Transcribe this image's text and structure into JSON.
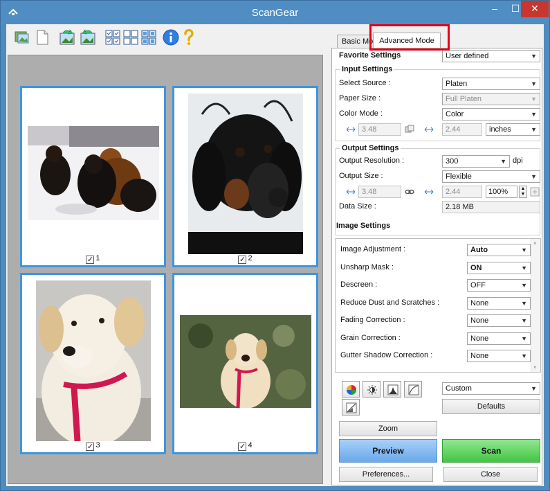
{
  "window": {
    "title": "ScanGear"
  },
  "window_controls": {
    "minimize": "–",
    "maximize": "☐",
    "close": "✕"
  },
  "toolbar": {
    "icons": [
      "open-image-icon",
      "new-document-icon",
      "rotate-left-icon",
      "rotate-right-icon",
      "auto-crop-icon",
      "deselect-all-icon",
      "select-all-icon",
      "info-icon",
      "help-icon"
    ]
  },
  "thumbnails": [
    {
      "number": "1",
      "checked": true,
      "subject": "three dogs"
    },
    {
      "number": "2",
      "checked": true,
      "subject": "dachshund"
    },
    {
      "number": "3",
      "checked": true,
      "subject": "labrador"
    },
    {
      "number": "4",
      "checked": true,
      "subject": "labrador on grass"
    }
  ],
  "tabs": {
    "basic": "Basic Mode",
    "advanced": "Advanced Mode"
  },
  "favorite": {
    "label": "Favorite Settings",
    "value": "User defined"
  },
  "input": {
    "title": "Input Settings",
    "source_label": "Select Source :",
    "source_value": "Platen",
    "paper_label": "Paper Size :",
    "paper_value": "Full Platen",
    "color_label": "Color Mode :",
    "color_value": "Color",
    "width": "3.48",
    "height": "2.44",
    "unit": "inches"
  },
  "output": {
    "title": "Output Settings",
    "resolution_label": "Output Resolution :",
    "resolution_value": "300",
    "dpi": "dpi",
    "size_label": "Output Size :",
    "size_value": "Flexible",
    "width": "3.48",
    "height": "2.44",
    "scale": "100%",
    "data_label": "Data Size :",
    "data_value": "2.18 MB"
  },
  "image_settings": {
    "title": "Image Settings",
    "rows": [
      {
        "label": "Image Adjustment :",
        "value": "Auto",
        "bold": true
      },
      {
        "label": "Unsharp Mask :",
        "value": "ON",
        "bold": true
      },
      {
        "label": "Descreen :",
        "value": "OFF",
        "bold": false
      },
      {
        "label": "Reduce Dust and Scratches :",
        "value": "None",
        "bold": false
      },
      {
        "label": "Fading Correction :",
        "value": "None",
        "bold": false
      },
      {
        "label": "Grain Correction :",
        "value": "None",
        "bold": false
      },
      {
        "label": "Gutter Shadow Correction :",
        "value": "None",
        "bold": false
      }
    ]
  },
  "adjust": {
    "preset": "Custom",
    "defaults": "Defaults"
  },
  "buttons": {
    "zoom": "Zoom",
    "preview": "Preview",
    "scan": "Scan",
    "preferences": "Preferences...",
    "close": "Close"
  },
  "colors": {
    "accent_blue": "#3d95e0",
    "preview_blue": "#7fb6ee",
    "scan_green": "#5dd45d",
    "highlight_red": "#e40012"
  }
}
